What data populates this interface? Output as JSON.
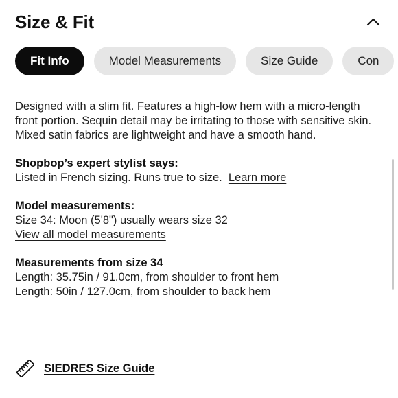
{
  "header": {
    "title": "Size & Fit",
    "collapse_icon": "chevron-up-icon"
  },
  "tabs": [
    {
      "label": "Fit Info",
      "active": true
    },
    {
      "label": "Model Measurements",
      "active": false
    },
    {
      "label": "Size Guide",
      "active": false
    },
    {
      "label": "Con",
      "active": false
    }
  ],
  "fit_info": {
    "description": "Designed with a slim fit. Features a high-low hem with a micro-length front portion. Sequin detail may be irritating to those with sensitive skin. Mixed satin fabrics are lightweight and have a smooth hand."
  },
  "stylist": {
    "heading": "Shopbop’s expert stylist says:",
    "text": "Listed in French sizing. Runs true to size.",
    "link": "Learn more"
  },
  "model": {
    "heading": "Model measurements:",
    "text": "Size 34: Moon (5'8\") usually wears size 32",
    "link": "View all model measurements"
  },
  "measurements": {
    "heading": "Measurements from size 34",
    "lines": [
      "Length: 35.75in / 91.0cm, from shoulder to front hem",
      "Length: 50in / 127.0cm, from shoulder to back hem"
    ]
  },
  "size_guide": {
    "icon": "ruler-icon",
    "label": "SIEDRES Size Guide"
  },
  "colors": {
    "active_tab_bg": "#0c0c0c",
    "inactive_tab_bg": "#e6e6e6",
    "text": "#1e1e1e"
  }
}
